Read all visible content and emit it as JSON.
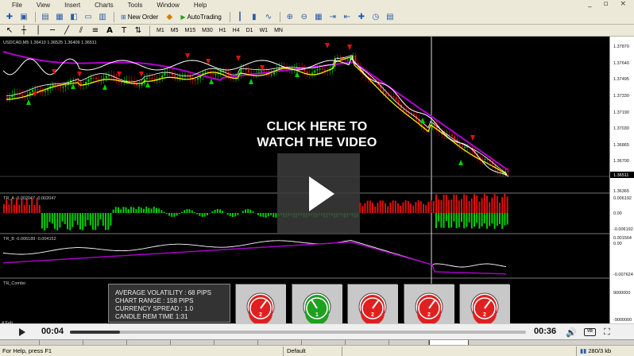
{
  "menubar": {
    "items": [
      "File",
      "View",
      "Insert",
      "Charts",
      "Tools",
      "Window",
      "Help"
    ],
    "window_controls": "_ ▫ ×"
  },
  "toolbar": {
    "new_order_label": "New Order",
    "autotrading_label": "AutoTrading"
  },
  "timeframes": [
    "M1",
    "M5",
    "M15",
    "M30",
    "H1",
    "H4",
    "D1",
    "W1",
    "MN"
  ],
  "chart": {
    "symbol_header": "USDCAD,M5  1.36410 1.36525 1.36409 1.36511",
    "price_axis": [
      "1.37870",
      "1.37640",
      "1.37495",
      "1.37330",
      "1.37190",
      "1.37030",
      "1.36865",
      "1.36700",
      "1.36511",
      "1.36365"
    ],
    "ind1_title": "TR_A -0.002047 -0.002047",
    "ind1_axis": [
      "0.006192",
      "0.00",
      "-0.006192"
    ],
    "ind2_title": "TR_B -0.006189 -0.004152",
    "ind2_axis": [
      "0.001564",
      "0.00",
      "-0.007624"
    ],
    "ind3_title": "TR_Combo",
    "ind3_axis": [
      "9000000",
      "-9000000"
    ],
    "date_label": "4 Feb",
    "colors": {
      "up": "#00d000",
      "down": "#e01010",
      "ma_yellow": "#ffff00",
      "ma_magenta": "#b000d0",
      "ma_white": "#ffffff"
    }
  },
  "overlay": {
    "line1": "CLICK HERE TO",
    "line2": "WATCH THE VIDEO"
  },
  "stats": {
    "line1": "AVERAGE VOLATILITY : 68 PIPS",
    "line2": "CHART RANGE : 158 PIPS",
    "line3": "CURRENCY SPREAD : 1.0",
    "line4": "CANDLE REM TIME    1:31"
  },
  "gauges": [
    {
      "face": "#e02020",
      "value": "2"
    },
    {
      "face": "#20a020",
      "value": "1"
    },
    {
      "face": "#e02020",
      "value": "2"
    },
    {
      "face": "#e02020",
      "value": "2"
    },
    {
      "face": "#e02020",
      "value": "2"
    }
  ],
  "player": {
    "current_time": "00:04",
    "total_time": "00:36",
    "progress": 0.11,
    "vr_label": "VR"
  },
  "status": {
    "help": "For Help, press F1",
    "profile": "Default",
    "traffic": "280/3 kb"
  }
}
